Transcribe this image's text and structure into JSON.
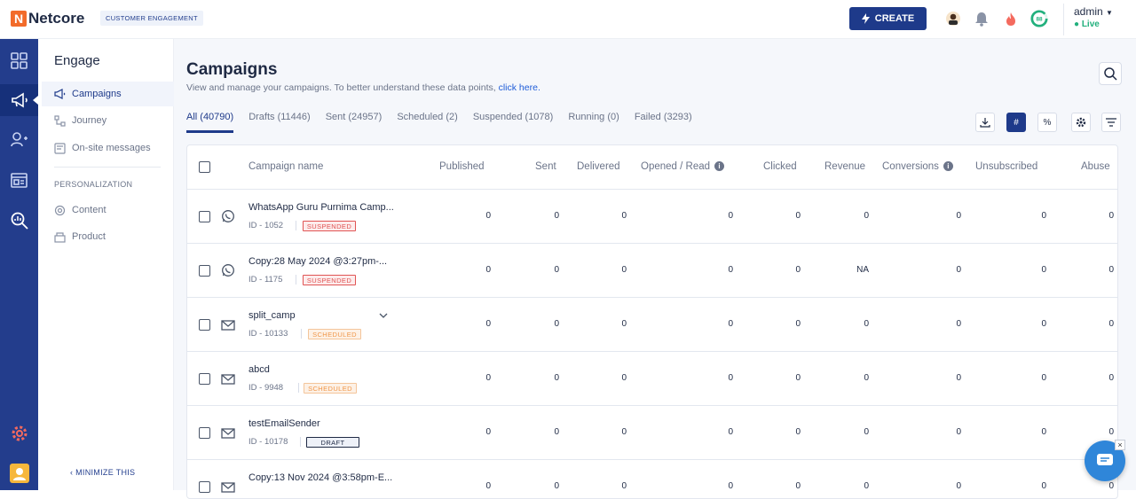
{
  "app": {
    "logo_text": "Netcore",
    "logo_mark": "N",
    "product_badge": "CUSTOMER ENGAGEMENT",
    "create_label": "CREATE",
    "user_name": "admin",
    "user_status": "Live",
    "score_badge": "88",
    "accent": "#1e3a8a"
  },
  "subnav": {
    "title": "Engage",
    "items": [
      {
        "label": "Campaigns",
        "icon": "megaphone-icon"
      },
      {
        "label": "Journey",
        "icon": "journey-icon"
      },
      {
        "label": "On-site messages",
        "icon": "onsite-icon"
      }
    ],
    "section_label": "PERSONALIZATION",
    "personalization_items": [
      {
        "label": "Content",
        "icon": "content-icon"
      },
      {
        "label": "Product",
        "icon": "product-icon"
      }
    ],
    "minimize_label": "MINIMIZE THIS"
  },
  "page": {
    "title": "Campaigns",
    "subtitle": "View and manage your campaigns. To better understand these data points, ",
    "subtitle_link": "click here."
  },
  "tabs": [
    {
      "label": "All (40790)"
    },
    {
      "label": "Drafts (11446)"
    },
    {
      "label": "Sent (24957)"
    },
    {
      "label": "Scheduled (2)"
    },
    {
      "label": "Suspended (1078)"
    },
    {
      "label": "Running (0)"
    },
    {
      "label": "Failed (3293)"
    }
  ],
  "toolbar": {
    "count_toggle": "#",
    "percent_toggle": "%"
  },
  "table": {
    "columns": [
      "Campaign name",
      "Published",
      "Sent",
      "Delivered",
      "Opened / Read",
      "Clicked",
      "Revenue",
      "Conversions",
      "Unsubscribed",
      "Abuse"
    ],
    "rows": [
      {
        "name": "WhatsApp Guru Purnima Camp...",
        "id": "ID - 1052",
        "status": "SUSPENDED",
        "channel": "whatsapp-icon",
        "values": [
          "0",
          "0",
          "0",
          "0",
          "0",
          "0",
          "0",
          "0",
          "0"
        ]
      },
      {
        "name": "Copy:28 May 2024 @3:27pm-...",
        "id": "ID - 1175",
        "status": "SUSPENDED",
        "channel": "whatsapp-icon",
        "values": [
          "0",
          "0",
          "0",
          "0",
          "0",
          "NA",
          "0",
          "0",
          "0"
        ]
      },
      {
        "name": "split_camp",
        "id": "ID - 10133",
        "status": "SCHEDULED",
        "channel": "email-icon",
        "values": [
          "0",
          "0",
          "0",
          "0",
          "0",
          "0",
          "0",
          "0",
          "0"
        ]
      },
      {
        "name": "abcd",
        "id": "ID - 9948",
        "status": "SCHEDULED",
        "channel": "email-icon",
        "values": [
          "0",
          "0",
          "0",
          "0",
          "0",
          "0",
          "0",
          "0",
          "0"
        ]
      },
      {
        "name": "testEmailSender",
        "id": "ID - 10178",
        "status": "DRAFT",
        "channel": "email-icon",
        "values": [
          "0",
          "0",
          "0",
          "0",
          "0",
          "0",
          "0",
          "0",
          "0"
        ]
      },
      {
        "name": "Copy:13 Nov 2024 @3:58pm-E...",
        "id": "",
        "status": "",
        "channel": "email-icon",
        "values": [
          "0",
          "0",
          "0",
          "0",
          "0",
          "0",
          "0",
          "0",
          "0"
        ]
      }
    ]
  }
}
